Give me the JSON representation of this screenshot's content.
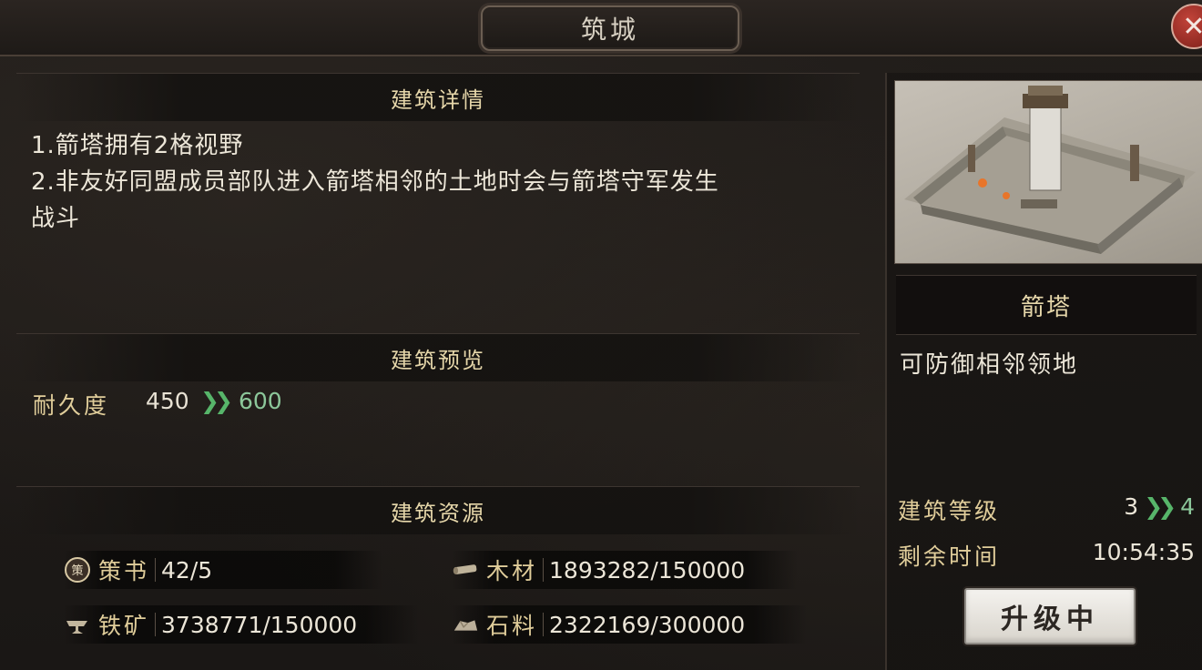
{
  "window": {
    "title": "筑城",
    "close_glyph": "✕"
  },
  "details": {
    "header": "建筑详情",
    "lines": [
      "1.箭塔拥有2格视野",
      "2.非友好同盟成员部队进入箭塔相邻的土地时会与箭塔守军发生",
      "战斗"
    ]
  },
  "preview": {
    "header": "建筑预览",
    "durability": {
      "label": "耐久度",
      "current": "450",
      "next": "600"
    }
  },
  "resources": {
    "header": "建筑资源",
    "items": [
      {
        "icon": "strategy-book-icon",
        "label": "策书",
        "value": "42/5"
      },
      {
        "icon": "wood-icon",
        "label": "木材",
        "value": "1893282/150000"
      },
      {
        "icon": "iron-icon",
        "label": "铁矿",
        "value": "3738771/150000"
      },
      {
        "icon": "stone-icon",
        "label": "石料",
        "value": "2322169/300000"
      }
    ]
  },
  "building": {
    "name": "箭塔",
    "description": "可防御相邻领地",
    "level_label": "建筑等级",
    "level_current": "3",
    "level_next": "4",
    "time_label": "剩余时间",
    "time_remaining": "10:54:35",
    "upgrade_button": "升级中"
  },
  "colors": {
    "accent_gold": "#e0cd9a",
    "upgrade_green": "#57b56a",
    "close_red": "#b8362d"
  }
}
